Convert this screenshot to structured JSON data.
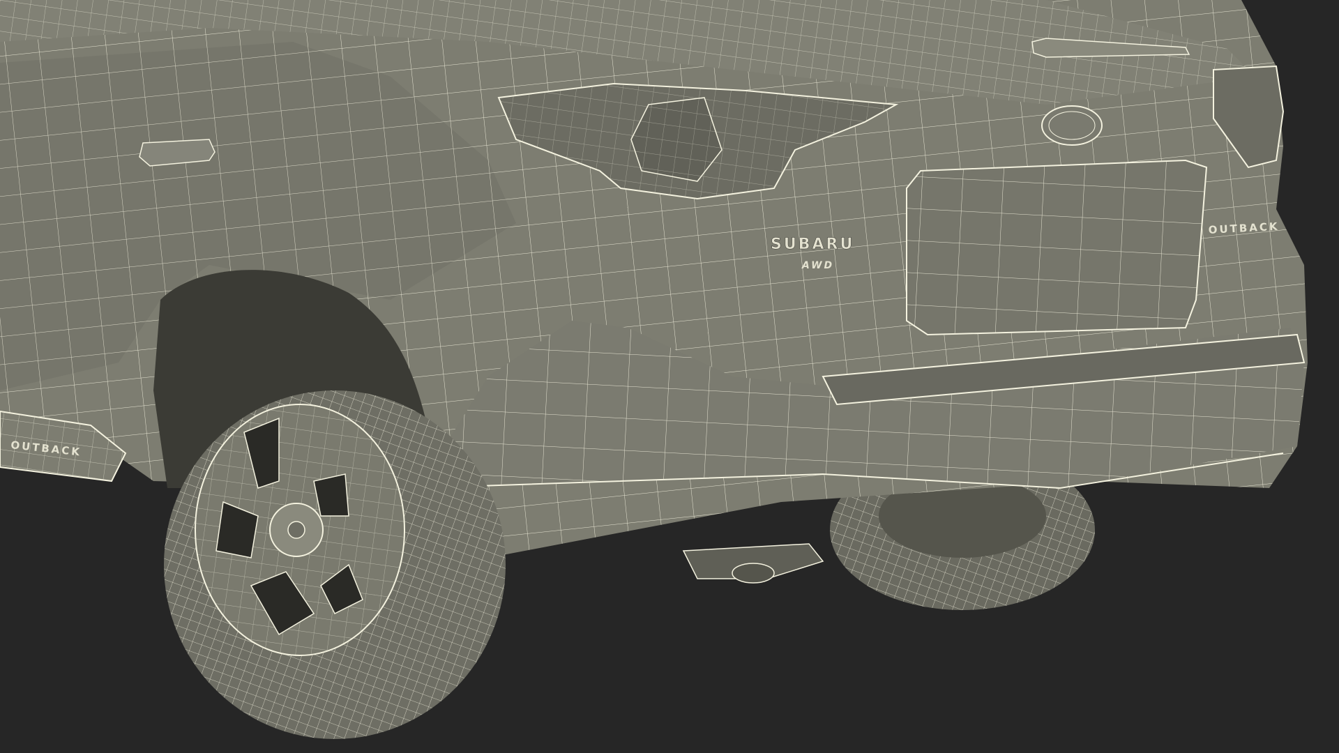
{
  "scene": {
    "subject": "3D wireframe render of the rear quarter of an SUV",
    "background_color": "#262626",
    "body_color": "#7a7a6e",
    "body_shadow_color": "#5e5e55",
    "wire_color": "#f4f2df",
    "tire_color": "#6e6e64"
  },
  "badges": {
    "brand": "SUBARU",
    "drive": "AWD",
    "model_rear": "OUTBACK",
    "model_side": "OUTBACK"
  }
}
